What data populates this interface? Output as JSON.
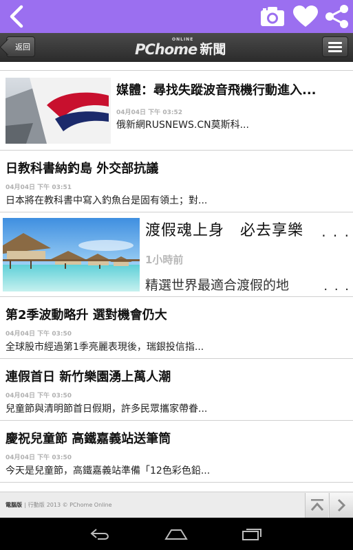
{
  "topbar": {
    "icons": [
      "chevron-left-icon",
      "camera-icon",
      "heart-icon",
      "share-icon"
    ],
    "color": "#9b6ff0"
  },
  "header": {
    "back_label": "返回",
    "logo_brand": "PChome",
    "logo_online": "ONLINE",
    "logo_section": "新聞"
  },
  "articles": [
    {
      "title": "媒體：尋找失蹤波音飛機行動進入...",
      "time": "04月04日 下午 03:52",
      "desc": "俄新網RUSNEWS.CN莫斯科..."
    },
    {
      "title": "日教科書納釣島 外交部抗議",
      "time": "04月04日 下午 03:51",
      "desc": "日本將在教科書中寫入釣魚台是固有領土；對..."
    },
    {
      "title": "渡假魂上身　必去享樂",
      "time": "1小時前",
      "desc": "精選世界最適合渡假的地"
    },
    {
      "title": "第2季波動略升 選對機會仍大",
      "time": "04月04日 下午 03:50",
      "desc": "全球股市經過第1季亮麗表現後，瑞銀投信指..."
    },
    {
      "title": "連假首日 新竹樂園湧上萬人潮",
      "time": "04月04日 下午 03:50",
      "desc": "兒童節與清明節首日假期，許多民眾攜家帶眷..."
    },
    {
      "title": "慶祝兒童節 高鐵嘉義站送筆筒",
      "time": "04月04日 下午 03:50",
      "desc": "今天是兒童節，高鐵嘉義站準備「12色彩色鉛..."
    }
  ],
  "ellipsis": ". . .",
  "footer": {
    "desktop": "電腦版",
    "divider": "|",
    "mobile": "行動版",
    "copyright": "2013 © PChome Online"
  }
}
